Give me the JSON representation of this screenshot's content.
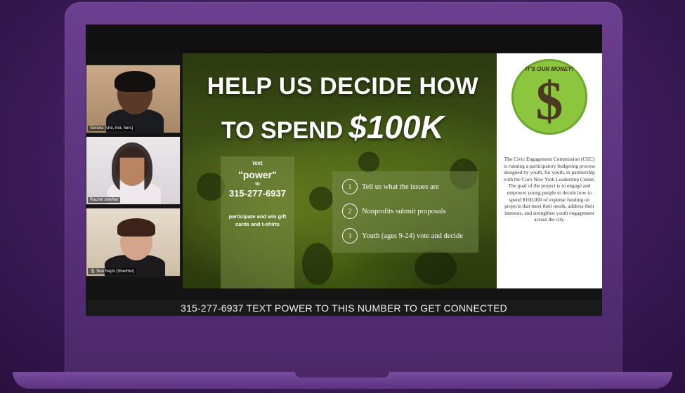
{
  "participants": [
    {
      "name": "Serena (she, her, hers)"
    },
    {
      "name": "Rachel she/her"
    },
    {
      "name": "Sue Najm (She/Her)"
    }
  ],
  "slide": {
    "headline_line1": "HELP US DECIDE HOW",
    "headline_line2": "TO SPEND",
    "headline_amount": "$100K",
    "text_prompt": "text",
    "text_keyword": "\"power\"",
    "text_to": "to",
    "text_number": "315-277-6937",
    "text_incentive": "participate and win gift cards and t-shirts",
    "steps": [
      {
        "num": "1",
        "label": "Tell us what the issues are"
      },
      {
        "num": "2",
        "label": "Nonprofits submit proposals"
      },
      {
        "num": "3",
        "label": "Youth (ages 9-24) vote and decide"
      }
    ],
    "badge_text": "IT'S OUR MONEY!",
    "badge_symbol": "$",
    "description": "The Civic Engagement Commission (CEC) is running a participatory budgeting process designed by youth, for youth, in partnership with the Coro New York Leadership Center. The goal of the project is to engage and empower young people to decide how to spend $100,000 of expense funding on projects that meet their needs, address their interests, and strengthen youth engagement across the city."
  },
  "caption": "315-277-6937 TEXT POWER TO THIS NUMBER TO GET CONNECTED",
  "colors": {
    "background": "#3e1d5c",
    "laptop": "#58307a",
    "badge_green": "#8cc63f"
  },
  "icons": {
    "mic": "mic-icon"
  }
}
